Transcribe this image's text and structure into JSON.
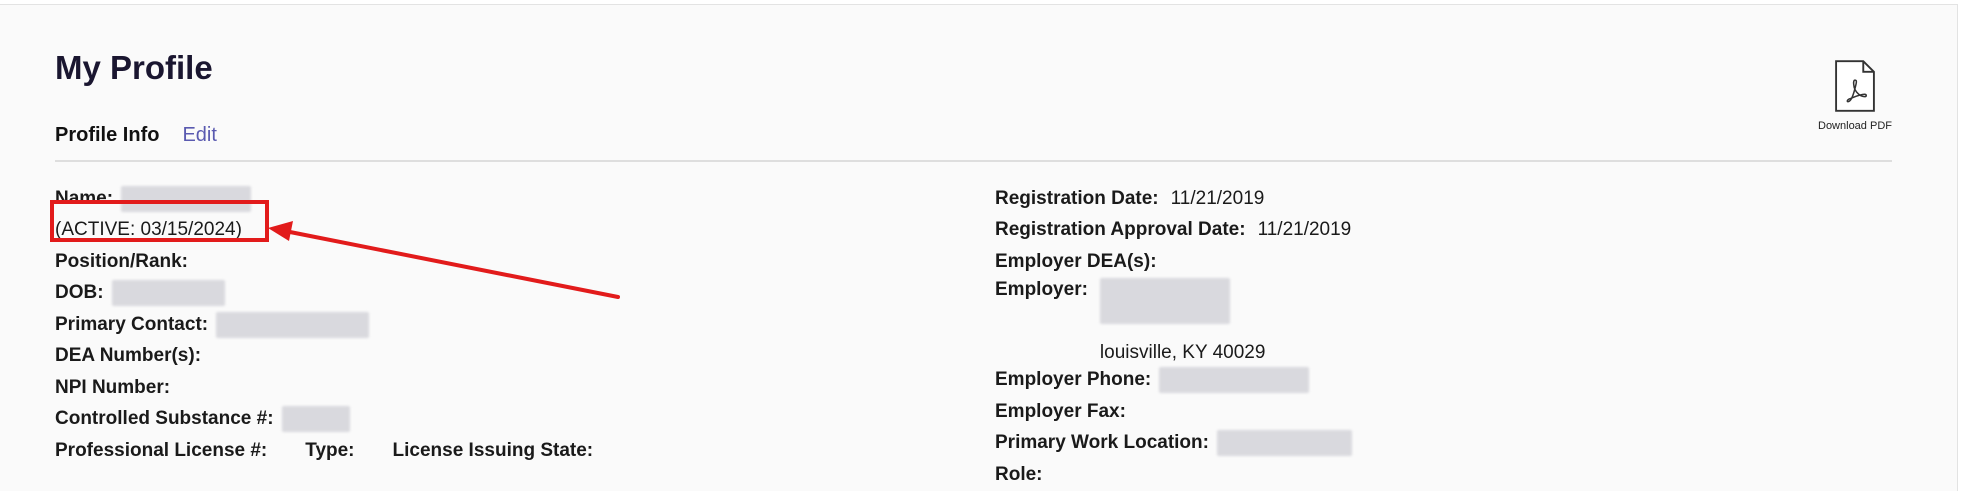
{
  "page": {
    "title": "My Profile",
    "section_title": "Profile Info",
    "edit_label": "Edit",
    "download_label": "Download PDF"
  },
  "left_fields": {
    "name_label": "Name:",
    "status": "(ACTIVE: 03/15/2024)",
    "position_label": "Position/Rank:",
    "dob_label": "DOB:",
    "primary_contact_label": "Primary Contact:",
    "dea_label": "DEA Number(s):",
    "npi_label": "NPI Number:",
    "controlled_label": "Controlled Substance #:",
    "license_label": "Professional License #:",
    "type_label": "Type:",
    "issuing_state_label": "License Issuing State:"
  },
  "right_fields": {
    "registration_date_label": "Registration Date:",
    "registration_date": "11/21/2019",
    "approval_date_label": "Registration Approval Date:",
    "approval_date": "11/21/2019",
    "employer_dea_label": "Employer DEA(s):",
    "employer_label": "Employer:",
    "employer_city": "louisville, KY 40029",
    "employer_phone_label": "Employer Phone:",
    "employer_fax_label": "Employer Fax:",
    "primary_work_label": "Primary Work Location:",
    "role_label": "Role:"
  },
  "colors": {
    "annotation": "#e21b1b",
    "link": "#5a5ab0"
  }
}
